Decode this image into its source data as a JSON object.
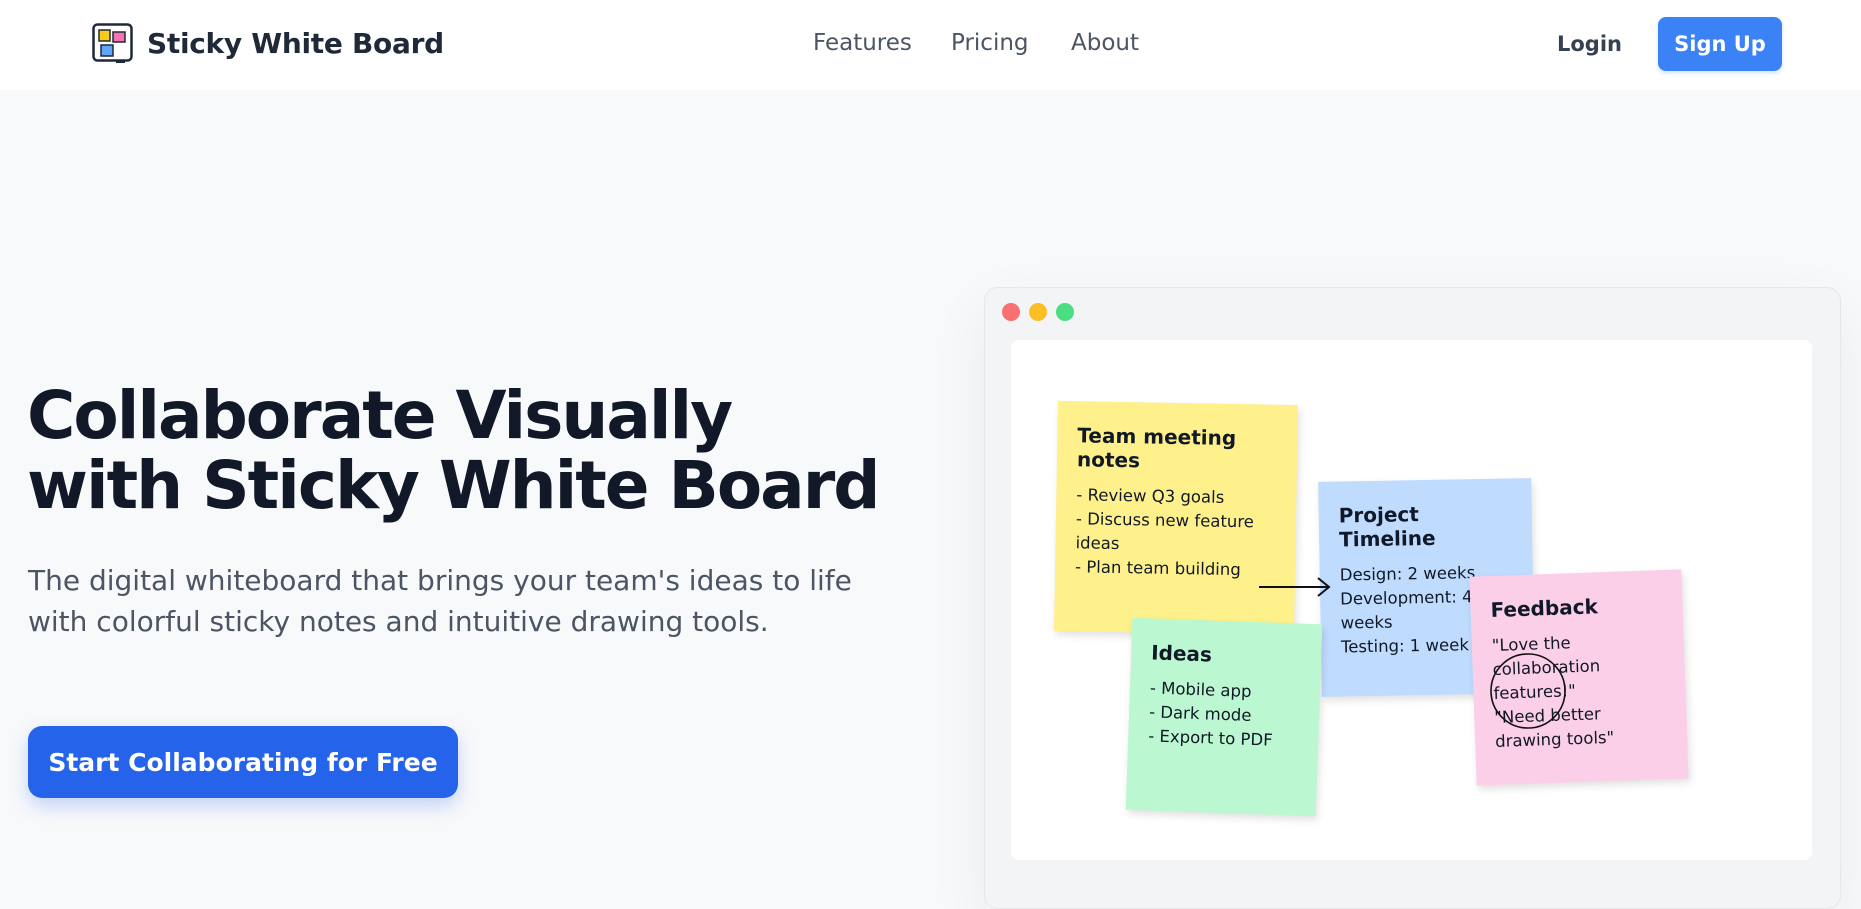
{
  "brand": {
    "name": "Sticky White Board"
  },
  "nav": {
    "links": [
      "Features",
      "Pricing",
      "About"
    ],
    "login": "Login",
    "signup": "Sign Up"
  },
  "hero": {
    "title": "Collaborate Visually with Sticky White Board",
    "subtitle": "The digital whiteboard that brings your team's ideas to life with colorful sticky notes and intuitive drawing tools.",
    "cta": "Start Collaborating for Free"
  },
  "preview": {
    "notes": [
      {
        "title": "Team meeting notes",
        "body": "- Review Q3 goals\n- Discuss new feature ideas\n- Plan team building",
        "color": "#fef08a"
      },
      {
        "title": "Project Timeline",
        "body": "Design: 2 weeks\nDevelopment: 4 weeks\nTesting: 1 week",
        "color": "#bfdbfe"
      },
      {
        "title": "Ideas",
        "body": "- Mobile app\n- Dark mode\n- Export to PDF",
        "color": "#bbf7d0"
      },
      {
        "title": "Feedback",
        "body": "\"Love the collaboration features!\"\n\"Need better drawing tools\"",
        "color": "#fbcfe8"
      }
    ],
    "window_dots": [
      "#f87171",
      "#fbbf24",
      "#4ade80"
    ]
  },
  "colors": {
    "primary": "#3b82f6",
    "cta": "#2563eb",
    "text": "#111827",
    "muted": "#4b5563"
  }
}
